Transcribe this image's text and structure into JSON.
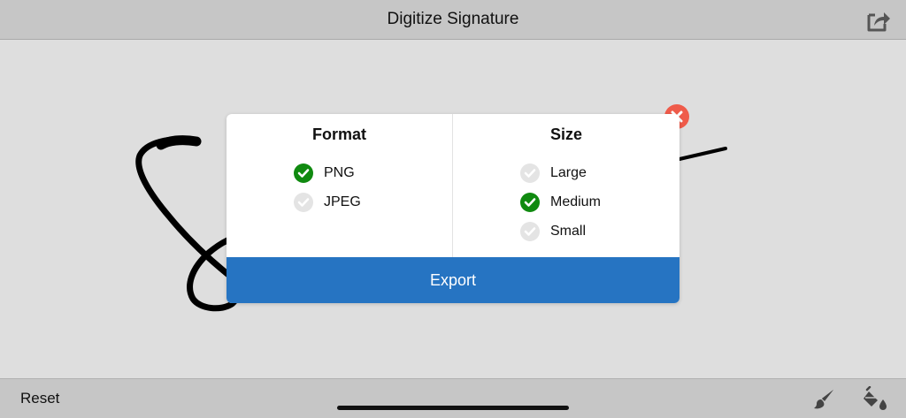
{
  "header": {
    "title": "Digitize Signature",
    "share_icon": "share-icon"
  },
  "dialog": {
    "format": {
      "title": "Format",
      "options": [
        {
          "label": "PNG",
          "selected": true
        },
        {
          "label": "JPEG",
          "selected": false
        }
      ]
    },
    "size": {
      "title": "Size",
      "options": [
        {
          "label": "Large",
          "selected": false
        },
        {
          "label": "Medium",
          "selected": true
        },
        {
          "label": "Small",
          "selected": false
        }
      ]
    },
    "export_label": "Export",
    "close_icon": "close-icon"
  },
  "toolbar": {
    "reset_label": "Reset",
    "brush_icon": "brush-icon",
    "fill_icon": "paint-bucket-icon"
  },
  "colors": {
    "accent": "#2674c2",
    "selected_check": "#108a10",
    "close": "#ef5b4a",
    "bar": "#c6c6c6",
    "canvas": "#dedede"
  }
}
